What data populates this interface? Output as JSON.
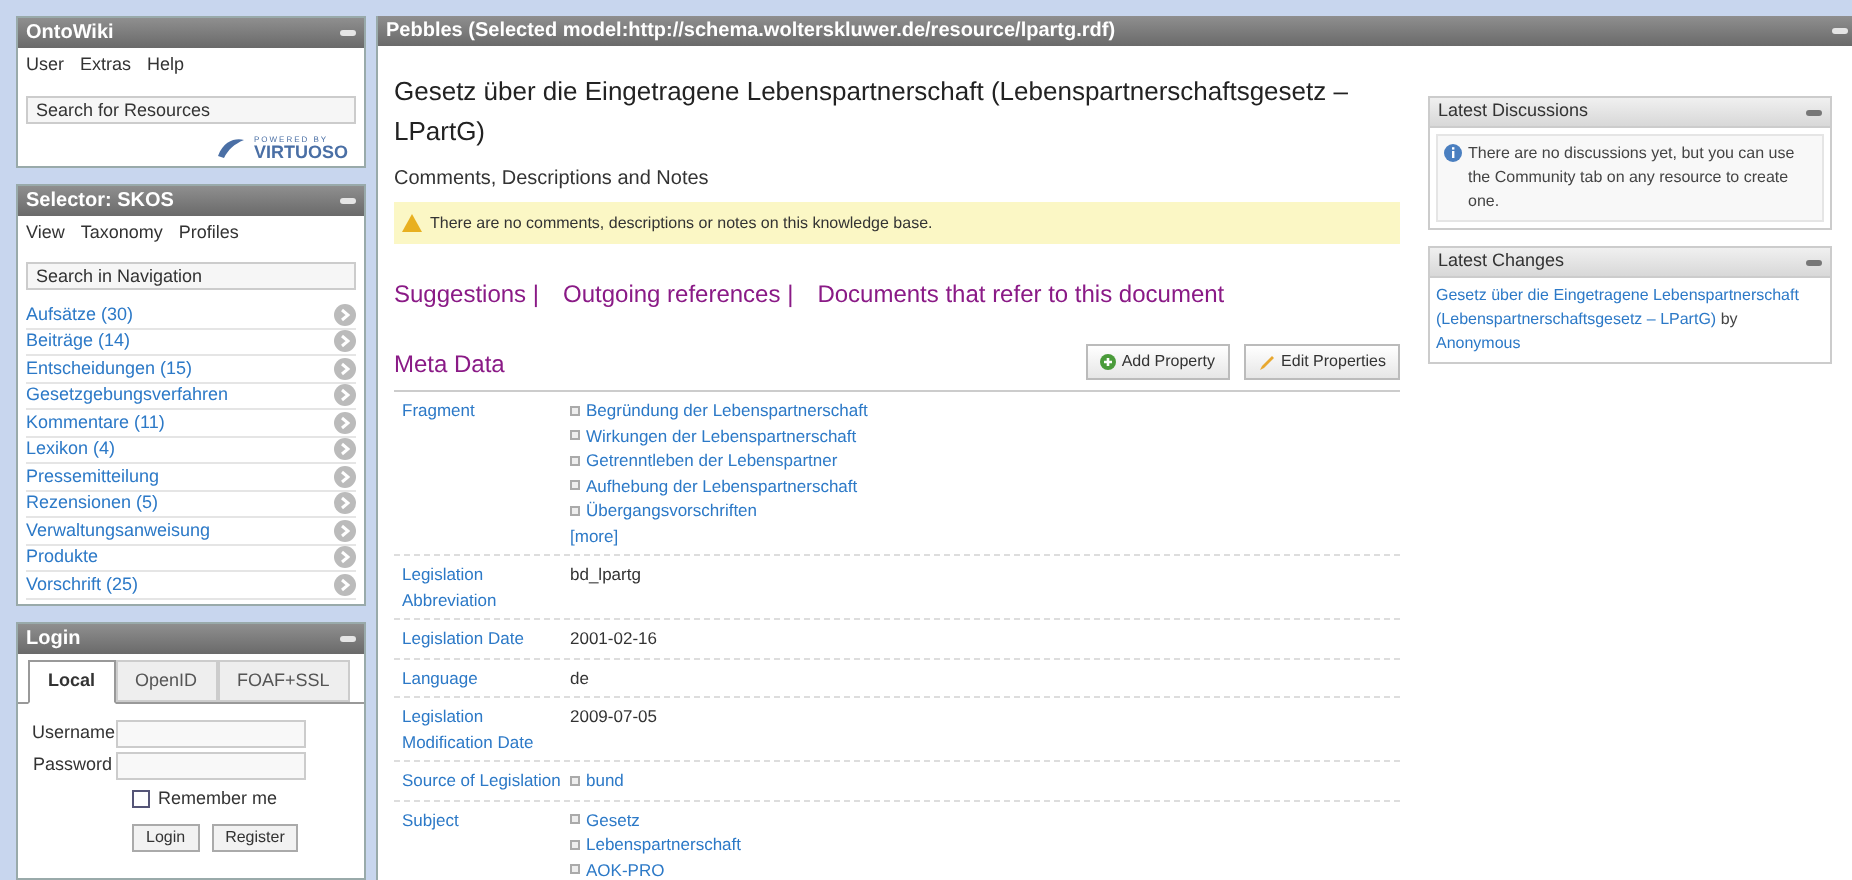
{
  "app_panel": {
    "title": "OntoWiki",
    "menu": [
      "User",
      "Extras",
      "Help"
    ],
    "search": {
      "placeholder": "Search for Resources"
    },
    "powered_by": "POWERED BY",
    "logo": "VIRTUOSO"
  },
  "selector": {
    "title": "Selector: SKOS",
    "menu": [
      "View",
      "Taxonomy",
      "Profiles"
    ],
    "search": {
      "placeholder": "Search in Navigation"
    },
    "items": [
      {
        "label": "Aufsätze (30)"
      },
      {
        "label": "Beiträge (14)"
      },
      {
        "label": "Entscheidungen (15)"
      },
      {
        "label": "Gesetzgebungsverfahren"
      },
      {
        "label": "Kommentare (11)"
      },
      {
        "label": "Lexikon (4)"
      },
      {
        "label": "Pressemitteilung"
      },
      {
        "label": "Rezensionen (5)"
      },
      {
        "label": "Verwaltungsanweisung"
      },
      {
        "label": "Produkte"
      },
      {
        "label": "Vorschrift (25)"
      }
    ]
  },
  "login": {
    "title": "Login",
    "tabs": [
      {
        "label": "Local",
        "selected": true
      },
      {
        "label": "OpenID",
        "selected": false
      },
      {
        "label": "FOAF+SSL",
        "selected": false
      }
    ],
    "fields": [
      {
        "label": "Username"
      },
      {
        "label": "Password"
      }
    ],
    "remember": {
      "label": "Remember me",
      "checked": false
    },
    "buttons": [
      "Login",
      "Register"
    ]
  },
  "main": {
    "title": "Pebbles (Selected model:http://schema.wolterskluwer.de/resource/lpartg.rdf)",
    "heading": "Gesetz über die Eingetragene Lebenspartnerschaft (Lebenspartnerschaftsgesetz – LPartG)",
    "comments_heading": "Comments, Descriptions and Notes",
    "warning": "There are no comments, descriptions or notes on this knowledge base.",
    "links": [
      "Suggestions |",
      "Outgoing references |",
      "Documents that refer to this document"
    ],
    "meta_heading": "Meta Data",
    "buttons": [
      {
        "label": "Add Property",
        "kind": "add"
      },
      {
        "label": "Edit Properties",
        "kind": "edit"
      }
    ],
    "rows": [
      {
        "property": "Fragment",
        "values": [
          {
            "text": "Begründung der Lebenspartnerschaft",
            "kind": "resource"
          },
          {
            "text": "Wirkungen der Lebenspartnerschaft",
            "kind": "resource"
          },
          {
            "text": "Getrenntleben der Lebenspartner",
            "kind": "resource"
          },
          {
            "text": "Aufhebung der Lebenspartnerschaft",
            "kind": "resource"
          },
          {
            "text": "Übergangsvorschriften",
            "kind": "resource"
          },
          {
            "text": "[more]",
            "kind": "more"
          }
        ]
      },
      {
        "property": "Legislation Abbreviation",
        "values": [
          {
            "text": "bd_lpartg",
            "kind": "literal"
          }
        ]
      },
      {
        "property": "Legislation Date",
        "values": [
          {
            "text": "2001-02-16",
            "kind": "literal"
          }
        ]
      },
      {
        "property": "Language",
        "values": [
          {
            "text": "de",
            "kind": "literal"
          }
        ]
      },
      {
        "property": "Legislation Modification Date",
        "values": [
          {
            "text": "2009-07-05",
            "kind": "literal"
          }
        ]
      },
      {
        "property": "Source of Legislation",
        "values": [
          {
            "text": "bund",
            "kind": "resource"
          }
        ]
      },
      {
        "property": "Subject",
        "values": [
          {
            "text": "Gesetz",
            "kind": "resource"
          },
          {
            "text": "Lebenspartnerschaft",
            "kind": "resource"
          },
          {
            "text": "AOK-PRO",
            "kind": "resource"
          }
        ]
      }
    ]
  },
  "discussions": {
    "title": "Latest Discussions",
    "message": "There are no discussions yet, but you can use the Community tab on any resource to create one."
  },
  "changes": {
    "title": "Latest Changes",
    "link": "Gesetz über die Eingetragene Lebenspartnerschaft (Lebenspartnerschaftsgesetz – LPartG)",
    "by": "by",
    "author": "Anonymous"
  }
}
